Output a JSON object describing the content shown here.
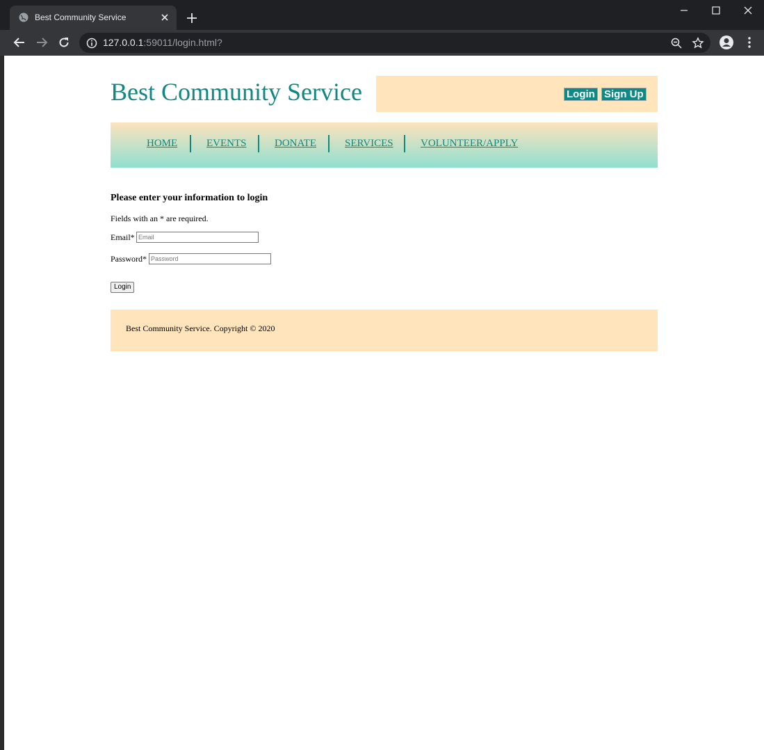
{
  "browser": {
    "tab_title": "Best Community Service",
    "url_host": "127.0.0.1",
    "url_rest": ":59011/login.html?"
  },
  "site": {
    "title": "Best Community Service",
    "auth": {
      "login_label": "Login",
      "signup_label": "Sign Up"
    },
    "nav": {
      "items": [
        {
          "label": "HOME"
        },
        {
          "label": "EVENTS"
        },
        {
          "label": "DONATE"
        },
        {
          "label": "SERVICES"
        },
        {
          "label": "VOLUNTEER/APPLY"
        }
      ]
    },
    "form": {
      "heading": "Please enter your information to login",
      "note": "Fields with an * are required.",
      "email_label": "Email*",
      "email_placeholder": "Email",
      "password_label": "Password*",
      "password_placeholder": "Password",
      "submit_label": "Login"
    },
    "footer": {
      "text": "Best Community Service. Copyright © 2020"
    }
  },
  "colors": {
    "accent": "#12877f",
    "header_box": "#ffe4bc",
    "button": "#0e8a86"
  }
}
